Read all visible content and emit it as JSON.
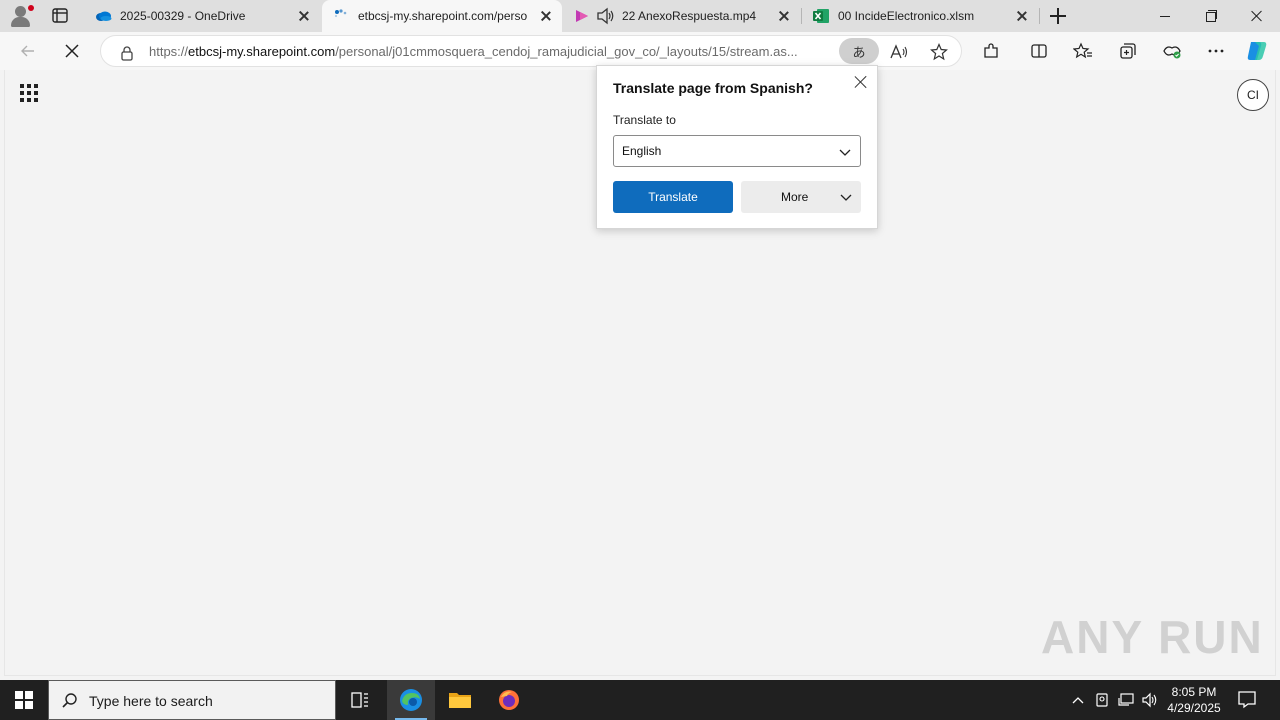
{
  "browser": {
    "tabs": [
      {
        "title": "2025-00329 - OneDrive",
        "icon": "onedrive-cloud-icon"
      },
      {
        "title": "etbcsj-my.sharepoint.com/perso",
        "icon": "loading-spinner-icon",
        "active": true
      },
      {
        "title": "22 AnexoRespuesta.mp4",
        "icon": "stream-video-icon"
      },
      {
        "title": "00 IncideElectronico.xlsm",
        "icon": "excel-icon"
      }
    ],
    "address": {
      "scheme": "https://",
      "host": "etbcsj-my.sharepoint.com",
      "path": "/personal/j01cmmosquera_cendoj_ramajudicial_gov_co/_layouts/15/stream.as..."
    },
    "translate_pill_glyph": "あ"
  },
  "page": {
    "avatar_initials": "CI",
    "watermark": "ANY RUN"
  },
  "translate_popup": {
    "title": "Translate page from Spanish?",
    "label": "Translate to",
    "selected_language": "English",
    "translate_button": "Translate",
    "more_button": "More"
  },
  "taskbar": {
    "search_placeholder": "Type here to search",
    "time": "8:05 PM",
    "date": "4/29/2025"
  },
  "colors": {
    "accent": "#0f6cbd",
    "taskbar": "#202020",
    "tabstrip": "#dfdfdf"
  }
}
